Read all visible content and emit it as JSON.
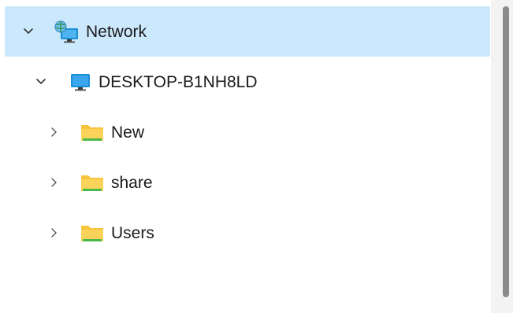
{
  "nav_tree": {
    "items": [
      {
        "label": "Network",
        "level": 0,
        "expanded": true,
        "selected": true,
        "icon": "network-icon"
      },
      {
        "label": "DESKTOP-B1NH8LD",
        "level": 1,
        "expanded": true,
        "selected": false,
        "icon": "computer-icon"
      },
      {
        "label": "New",
        "level": 2,
        "expanded": false,
        "selected": false,
        "icon": "folder-icon"
      },
      {
        "label": "share",
        "level": 2,
        "expanded": false,
        "selected": false,
        "icon": "folder-icon"
      },
      {
        "label": "Users",
        "level": 2,
        "expanded": false,
        "selected": false,
        "icon": "folder-icon"
      }
    ]
  },
  "colors": {
    "selection": "#cce8fd",
    "folder": "#f8c43c",
    "folder_accent": "#4cb848",
    "monitor": "#1a8fd8",
    "scrollbar_thumb": "#8a8a8a"
  }
}
